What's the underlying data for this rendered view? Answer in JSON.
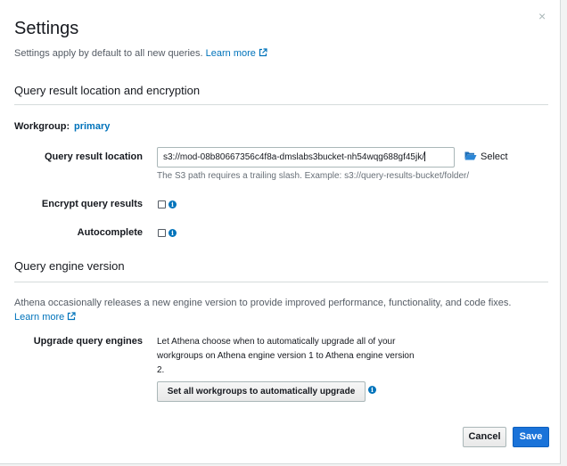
{
  "dialog": {
    "title": "Settings",
    "close_glyph": "×",
    "intro_text": "Settings apply by default to all new queries.",
    "learn_more": "Learn more"
  },
  "query_result": {
    "section_title": "Query result location and encryption",
    "workgroup_label": "Workgroup:",
    "workgroup_value": "primary",
    "location_label": "Query result location",
    "location_value": "s3://mod-08b80667356c4f8a-dmslabs3bucket-nh54wqg688gf45jk/",
    "select_label": "Select",
    "location_hint": "The S3 path requires a trailing slash. Example: s3://query-results-bucket/folder/",
    "encrypt_label": "Encrypt query results",
    "encrypt_checked": false,
    "autocomplete_label": "Autocomplete",
    "autocomplete_checked": false
  },
  "engine": {
    "section_title": "Query engine version",
    "description": "Athena occasionally releases a new engine version to provide improved performance, functionality, and code fixes.",
    "learn_more": "Learn more",
    "upgrade_label": "Upgrade query engines",
    "upgrade_description": "Let Athena choose when to automatically upgrade all of your workgroups on Athena engine version 1 to Athena engine version 2.",
    "upgrade_button": "Set all workgroups to automatically upgrade"
  },
  "footer": {
    "cancel_label": "Cancel",
    "save_label": "Save"
  },
  "colors": {
    "link": "#0073bb",
    "primary_button": "#1a73d9",
    "divider": "#d5dbdb"
  },
  "icons": [
    "close-icon",
    "external-link-icon",
    "folder-open-icon",
    "info-icon"
  ]
}
